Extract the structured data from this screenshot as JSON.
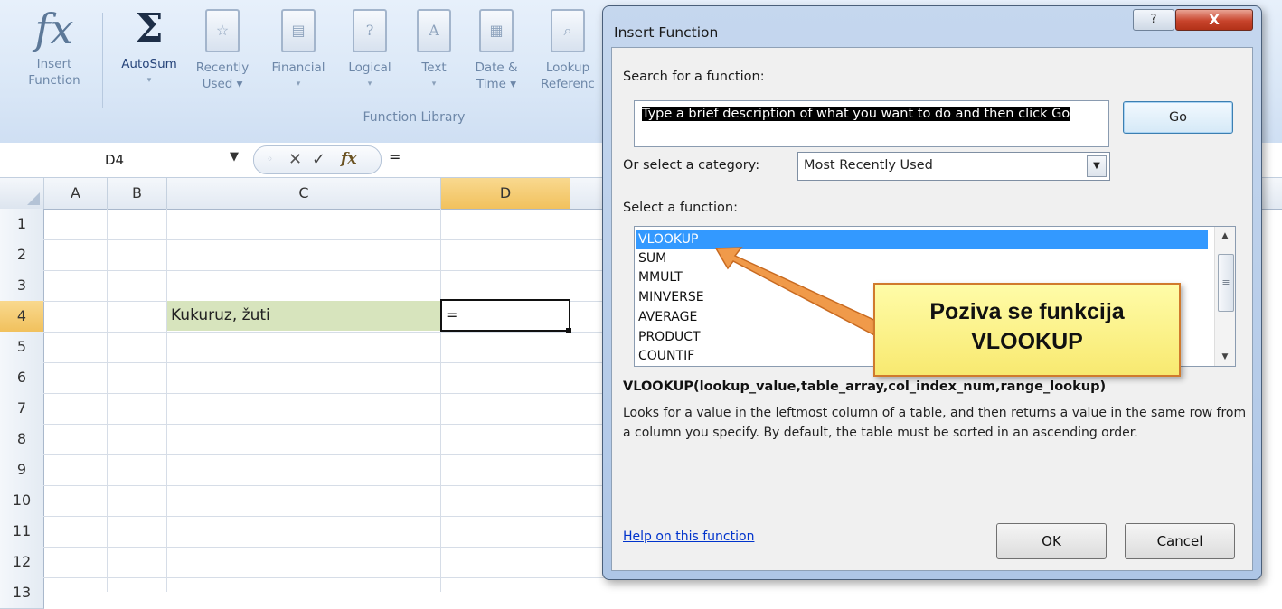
{
  "ribbon": {
    "buttons": [
      {
        "line1": "Insert",
        "line2": "Function",
        "icon": "fx-icon"
      },
      {
        "line1": "AutoSum",
        "line2": "▾",
        "icon": "sigma-icon"
      },
      {
        "line1": "Recently",
        "line2": "Used ▾",
        "icon": "book-star-icon"
      },
      {
        "line1": "Financial",
        "line2": "▾",
        "icon": "book-coins-icon"
      },
      {
        "line1": "Logical",
        "line2": "▾",
        "icon": "book-question-icon"
      },
      {
        "line1": "Text",
        "line2": "▾",
        "icon": "book-a-icon"
      },
      {
        "line1": "Date &",
        "line2": "Time ▾",
        "icon": "book-calendar-icon"
      },
      {
        "line1": "Lookup",
        "line2": "Referenc",
        "icon": "book-magnifier-icon"
      }
    ],
    "group_label": "Function Library"
  },
  "formula_bar": {
    "name_box": "D4",
    "cancel_glyph": "✕",
    "enter_glyph": "✓",
    "fx_glyph": "fx",
    "content": "="
  },
  "sheet": {
    "columns": [
      "A",
      "B",
      "C",
      "D"
    ],
    "rows": [
      "1",
      "2",
      "3",
      "4",
      "5",
      "6",
      "7",
      "8",
      "9",
      "10",
      "11",
      "12",
      "13"
    ],
    "selected_cell": "D4",
    "cells": {
      "C4": "Kukuruz, žuti",
      "D4": "="
    },
    "highlight_color": "#d7e4bd"
  },
  "dialog": {
    "title": "Insert Function",
    "help_glyph": "?",
    "close_glyph": "X",
    "search_label": "Search for a function:",
    "search_value": "Type a brief description of what you want to do and then click Go",
    "go_label": "Go",
    "category_label": "Or select a category:",
    "category_value": "Most Recently Used",
    "function_label": "Select a function:",
    "functions": [
      "VLOOKUP",
      "SUM",
      "MMULT",
      "MINVERSE",
      "AVERAGE",
      "PRODUCT",
      "COUNTIF"
    ],
    "selected_function": "VLOOKUP",
    "syntax": "VLOOKUP(lookup_value,table_array,col_index_num,range_lookup)",
    "description": "Looks for a value in the leftmost column of a table, and then returns a value in the same row from a column you specify. By default, the table must be sorted in an ascending order.",
    "help_link": "Help on this function",
    "ok_label": "OK",
    "cancel_label": "Cancel"
  },
  "callout": {
    "line1": "Poziva se funkcija",
    "line2": "VLOOKUP",
    "border_color": "#d07a2d",
    "fill_color": "#f8e970"
  }
}
